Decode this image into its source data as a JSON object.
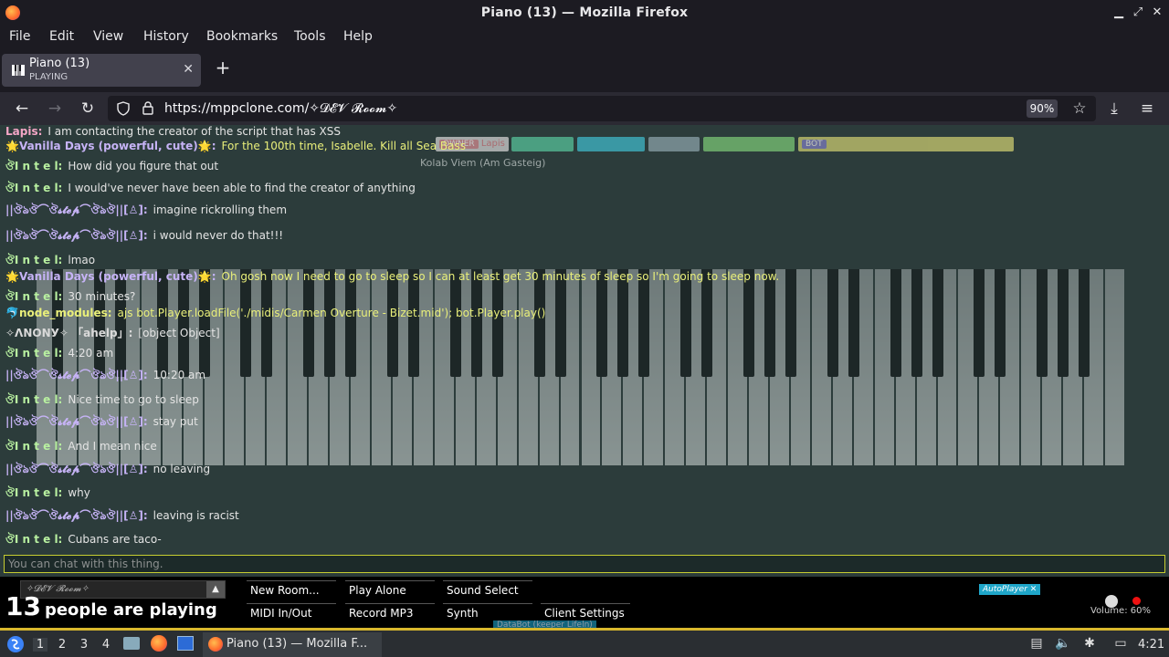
{
  "window": {
    "title": "Piano (13) — Mozilla Firefox"
  },
  "menu": [
    "File",
    "Edit",
    "View",
    "History",
    "Bookmarks",
    "Tools",
    "Help"
  ],
  "tab": {
    "title": "Piano (13)",
    "subtitle": "PLAYING"
  },
  "address": {
    "url": "https://mppclone.com/✧𝓓𝓔𝓥 𝓡𝓸𝓸𝓶✧",
    "zoom": "90%"
  },
  "chat": {
    "messages": [
      {
        "name": "Lapis:",
        "text": "I am contacting the creator of the script that has XSS",
        "color": "#f4a6c6",
        "text_color": "#e4e4e4"
      },
      {
        "name": "🌟Vanilla Days (powerful, cute)🌟:",
        "text": "For the 100th time, Isabelle. Kill all Sea Bass",
        "color": "#c6b3f6",
        "text_color": "#e9ef7a"
      },
      {
        "name": "ঔI n t e l:",
        "text": "How did you figure that out",
        "color": "#b8f0a0",
        "text_color": "#e4e4e4"
      },
      {
        "name": "ঔI n t e l:",
        "text": "I would've never have been able to find the creator of anything",
        "color": "#b8f0a0",
        "text_color": "#e4e4e4"
      },
      {
        "name": "||ঔঌঔ⌒ঔ𝓼𝓽𝓮𝓹⌒ঔঌঔ||[♙]:",
        "text": "imagine rickrolling them",
        "color": "#c6b3f6",
        "text_color": "#e4e4e4"
      },
      {
        "name": "||ঔঌঔ⌒ঔ𝓼𝓽𝓮𝓹⌒ঔঌঔ||[♙]:",
        "text": "i would never do that!!!",
        "color": "#c6b3f6",
        "text_color": "#e4e4e4"
      },
      {
        "name": "ঔI n t e l:",
        "text": "lmao",
        "color": "#b8f0a0",
        "text_color": "#e4e4e4"
      },
      {
        "name": "🌟Vanilla Days (powerful, cute)🌟:",
        "text": "Oh gosh now I need to go to sleep so I can at least get 30 minutes of sleep so I'm going to sleep now.",
        "color": "#c6b3f6",
        "text_color": "#e9ef7a"
      },
      {
        "name": "ঔI n t e l:",
        "text": "30 minutes?",
        "color": "#b8f0a0",
        "text_color": "#e4e4e4"
      },
      {
        "name": "🐬node_modules:",
        "text": "ajs bot.Player.loadFile('./midis/Carmen Overture - Bizet.mid'); bot.Player.play()",
        "color": "#e9ef7a",
        "text_color": "#e9ef7a"
      },
      {
        "name": "✧ΛΝΟΝУ✧ 「ahelp」:",
        "text": "[object Object]",
        "color": "#d9d9d9",
        "text_color": "#e4e4e4"
      },
      {
        "name": "ঔI n t e l:",
        "text": "4:20 am",
        "color": "#b8f0a0",
        "text_color": "#e4e4e4"
      },
      {
        "name": "||ঔঌঔ⌒ঔ𝓼𝓽𝓮𝓹⌒ঔঌঔ||[♙]:",
        "text": "10:20 am",
        "color": "#c6b3f6",
        "text_color": "#e4e4e4"
      },
      {
        "name": "ঔI n t e l:",
        "text": "Nice time to go to sleep",
        "color": "#b8f0a0",
        "text_color": "#e4e4e4"
      },
      {
        "name": "||ঔঌঔ⌒ঔ𝓼𝓽𝓮𝓹⌒ঔঌঔ||[♙]:",
        "text": "stay put",
        "color": "#c6b3f6",
        "text_color": "#e4e4e4"
      },
      {
        "name": "ঔI n t e l:",
        "text": "And I mean nice",
        "color": "#b8f0a0",
        "text_color": "#e4e4e4"
      },
      {
        "name": "||ঔঌঔ⌒ঔ𝓼𝓽𝓮𝓹⌒ঔঌঔ||[♙]:",
        "text": "no leaving",
        "color": "#c6b3f6",
        "text_color": "#e4e4e4"
      },
      {
        "name": "ঔI n t e l:",
        "text": "why",
        "color": "#b8f0a0",
        "text_color": "#e4e4e4"
      },
      {
        "name": "||ঔঌঔ⌒ঔ𝓼𝓽𝓮𝓹⌒ঔঌঔ||[♙]:",
        "text": "leaving is racist",
        "color": "#c6b3f6",
        "text_color": "#e4e4e4"
      },
      {
        "name": "ঔI n t e l:",
        "text": "Cubans are taco-",
        "color": "#b8f0a0",
        "text_color": "#e4e4e4"
      }
    ],
    "placeholder": "You can chat with this thing."
  },
  "users": {
    "tags": [
      {
        "label": "OWNER",
        "color": "#d47b82"
      },
      {
        "label": "Lapis",
        "color": "#d47b82"
      },
      {
        "label": "BOT",
        "color": "#6b6bd1"
      }
    ],
    "floating": [
      "Kolab Viem (Am Gasteig)",
      "AutoPlayer ✕",
      "DataBot (keeper Lifeln)"
    ]
  },
  "footer": {
    "room": "✧𝓓𝓔𝓥 𝓡𝓸𝓸𝓶✧",
    "count": "13",
    "count_label": "people are playing",
    "buttons": [
      "New Room...",
      "Play Alone",
      "Sound Select",
      "MIDI In/Out",
      "Record MP3",
      "Synth",
      "Client Settings"
    ],
    "volume": "Volume: 60%"
  },
  "taskbar": {
    "workspaces": [
      "1",
      "2",
      "3",
      "4"
    ],
    "task": "Piano (13) — Mozilla F...",
    "clock": "4:21"
  },
  "colors": {
    "accent": "#c7cd31",
    "piano_bg": "#2c3c3b"
  }
}
